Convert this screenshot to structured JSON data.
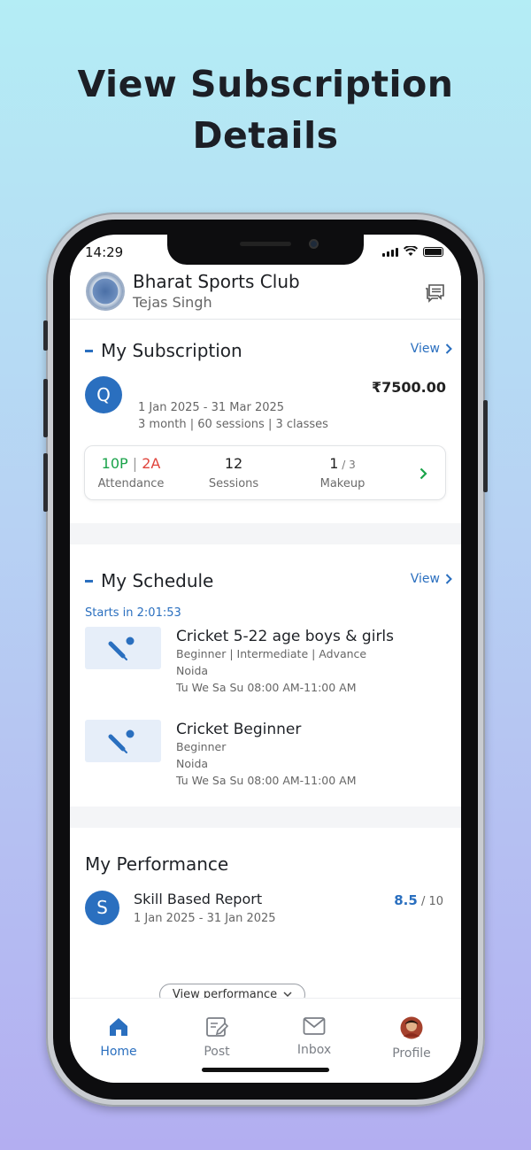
{
  "headline": {
    "line1": "View Subscription",
    "line2": "Details"
  },
  "status_bar": {
    "time": "14:29"
  },
  "header": {
    "club_name": "Bharat Sports Club",
    "user_name": "Tejas Singh"
  },
  "subscription": {
    "title": "My Subscription",
    "view_label": "View",
    "plan_initial": "Q",
    "price": "₹7500.00",
    "dates": "1 Jan 2025 - 31 Mar 2025",
    "details": "3 month | 60 sessions | 3 classes",
    "attendance_present": "10P",
    "attendance_sep": " | ",
    "attendance_absent": "2A",
    "attendance_label": "Attendance",
    "sessions_value": "12",
    "sessions_label": "Sessions",
    "makeup_value": "1",
    "makeup_total": " / 3",
    "makeup_label": "Makeup"
  },
  "schedule": {
    "title": "My Schedule",
    "view_label": "View",
    "starts_in": "Starts in 2:01:53",
    "classes": [
      {
        "title": "Cricket 5-22 age boys & girls",
        "levels": "Beginner | Intermediate | Advance",
        "location": "Noida",
        "timing": "Tu We Sa Su 08:00 AM-11:00 AM"
      },
      {
        "title": "Cricket Beginner",
        "levels": "Beginner",
        "location": "Noida",
        "timing": "Tu We Sa Su 08:00 AM-11:00 AM"
      }
    ]
  },
  "performance": {
    "title": "My Performance",
    "report_initial": "S",
    "report_title": "Skill Based Report",
    "report_dates": "1 Jan 2025 - 31 Jan 2025",
    "score": "8.5",
    "score_total": " / 10",
    "view_button": "View performance"
  },
  "tabs": [
    {
      "label": "Home",
      "icon": "home-icon",
      "active": true
    },
    {
      "label": "Post",
      "icon": "post-icon",
      "active": false
    },
    {
      "label": "Inbox",
      "icon": "inbox-icon",
      "active": false
    },
    {
      "label": "Profile",
      "icon": "profile-avatar",
      "active": false
    }
  ],
  "colors": {
    "accent": "#2a6fbf",
    "present": "#1aa34a",
    "absent": "#e0443c"
  }
}
